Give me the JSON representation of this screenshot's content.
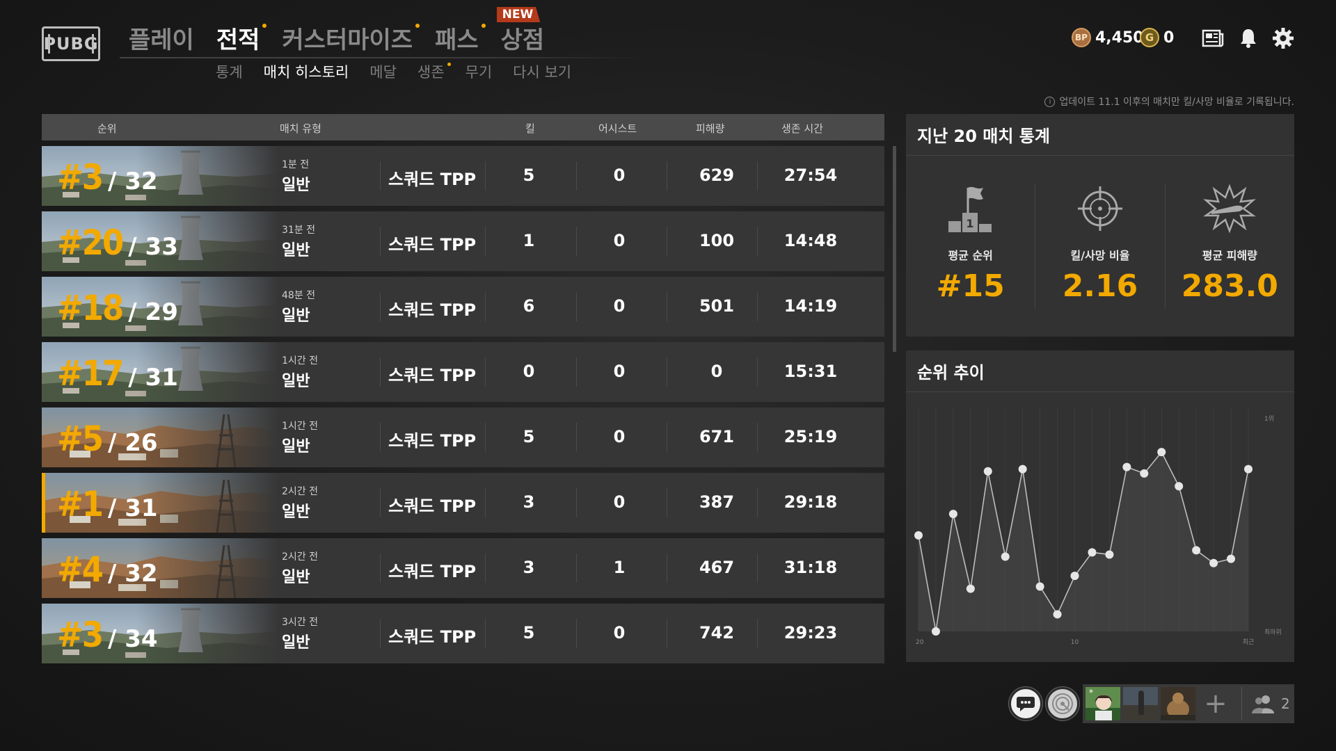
{
  "header": {
    "logo": "PUBG",
    "nav": [
      {
        "label": "플레이",
        "active": false,
        "dot": false
      },
      {
        "label": "전적",
        "active": true,
        "dot": true
      },
      {
        "label": "커스터마이즈",
        "active": false,
        "dot": true
      },
      {
        "label": "패스",
        "active": false,
        "dot": true
      },
      {
        "label": "상점",
        "active": false,
        "dot": false
      }
    ],
    "new_badge": "NEW",
    "subnav": [
      {
        "label": "통계",
        "active": false,
        "dot": false
      },
      {
        "label": "매치 히스토리",
        "active": true,
        "dot": false
      },
      {
        "label": "메달",
        "active": false,
        "dot": false
      },
      {
        "label": "생존",
        "active": false,
        "dot": true
      },
      {
        "label": "무기",
        "active": false,
        "dot": false
      },
      {
        "label": "다시 보기",
        "active": false,
        "dot": false
      }
    ],
    "bp_icon_text": "BP",
    "bp_amount": "4,450",
    "g_icon_text": "G",
    "g_amount": "0",
    "icons": [
      "news-icon",
      "bell-icon",
      "gear-icon"
    ]
  },
  "notice": "업데이트 11.1 이후의 매치만 킬/사망 비율로 기록됩니다.",
  "notice_icon_text": "i",
  "table": {
    "headers": {
      "rank": "순위",
      "match_type": "매치 유형",
      "kills": "킬",
      "assists": "어시스트",
      "damage": "피해량",
      "survival": "생존 시간"
    },
    "rows": [
      {
        "rank": "#3",
        "total": "/ 32",
        "time": "1분 전",
        "type": "일반",
        "mode": "스쿼드 TPP",
        "kills": "5",
        "assists": "0",
        "damage": "629",
        "survival": "27:54",
        "map": "erangel",
        "selected": false
      },
      {
        "rank": "#20",
        "total": "/ 33",
        "time": "31분 전",
        "type": "일반",
        "mode": "스쿼드 TPP",
        "kills": "1",
        "assists": "0",
        "damage": "100",
        "survival": "14:48",
        "map": "erangel",
        "selected": false
      },
      {
        "rank": "#18",
        "total": "/ 29",
        "time": "48분 전",
        "type": "일반",
        "mode": "스쿼드 TPP",
        "kills": "6",
        "assists": "0",
        "damage": "501",
        "survival": "14:19",
        "map": "erangel",
        "selected": false
      },
      {
        "rank": "#17",
        "total": "/ 31",
        "time": "1시간 전",
        "type": "일반",
        "mode": "스쿼드 TPP",
        "kills": "0",
        "assists": "0",
        "damage": "0",
        "survival": "15:31",
        "map": "erangel",
        "selected": false
      },
      {
        "rank": "#5",
        "total": "/ 26",
        "time": "1시간 전",
        "type": "일반",
        "mode": "스쿼드 TPP",
        "kills": "5",
        "assists": "0",
        "damage": "671",
        "survival": "25:19",
        "map": "miramar",
        "selected": false
      },
      {
        "rank": "#1",
        "total": "/ 31",
        "time": "2시간 전",
        "type": "일반",
        "mode": "스쿼드 TPP",
        "kills": "3",
        "assists": "0",
        "damage": "387",
        "survival": "29:18",
        "map": "miramar",
        "selected": true
      },
      {
        "rank": "#4",
        "total": "/ 32",
        "time": "2시간 전",
        "type": "일반",
        "mode": "스쿼드 TPP",
        "kills": "3",
        "assists": "1",
        "damage": "467",
        "survival": "31:18",
        "map": "miramar",
        "selected": false
      },
      {
        "rank": "#3",
        "total": "/ 34",
        "time": "3시간 전",
        "type": "일반",
        "mode": "스쿼드 TPP",
        "kills": "5",
        "assists": "0",
        "damage": "742",
        "survival": "29:23",
        "map": "erangel",
        "selected": false
      }
    ]
  },
  "stats_panel": {
    "title": "지난 20 매치 통계",
    "avg_rank_label": "평균 순위",
    "avg_rank_value": "#15",
    "kd_label": "킬/사망 비율",
    "kd_value": "2.16",
    "avg_damage_label": "평균 피해량",
    "avg_damage_value": "283.0"
  },
  "trend_panel": {
    "title": "순위 추이"
  },
  "chart_data": {
    "type": "line",
    "x_tick_labels": [
      "20",
      "10",
      "최근"
    ],
    "y_tick_labels": [
      "1위",
      "최하위"
    ],
    "values": [
      0.45,
      0.0,
      0.55,
      0.2,
      0.75,
      0.35,
      0.76,
      0.21,
      0.08,
      0.26,
      0.37,
      0.36,
      0.77,
      0.74,
      0.84,
      0.68,
      0.38,
      0.32,
      0.34,
      0.76
    ],
    "value_scale": "0 = 최하위, 1 = 1위",
    "colors": {
      "line": "#bdbdbd",
      "point": "#e6e6e6",
      "fill": "#4a4a4a"
    }
  },
  "bottom_bar": {
    "chat_icon": "chat-icon",
    "voice_icon": "voice-icon",
    "party_count": "2",
    "add_label": "+"
  },
  "colors": {
    "accent": "#f2a900",
    "row_bg": "#363636",
    "header_bg": "#4a4a4a",
    "panel_bg": "#323232"
  }
}
